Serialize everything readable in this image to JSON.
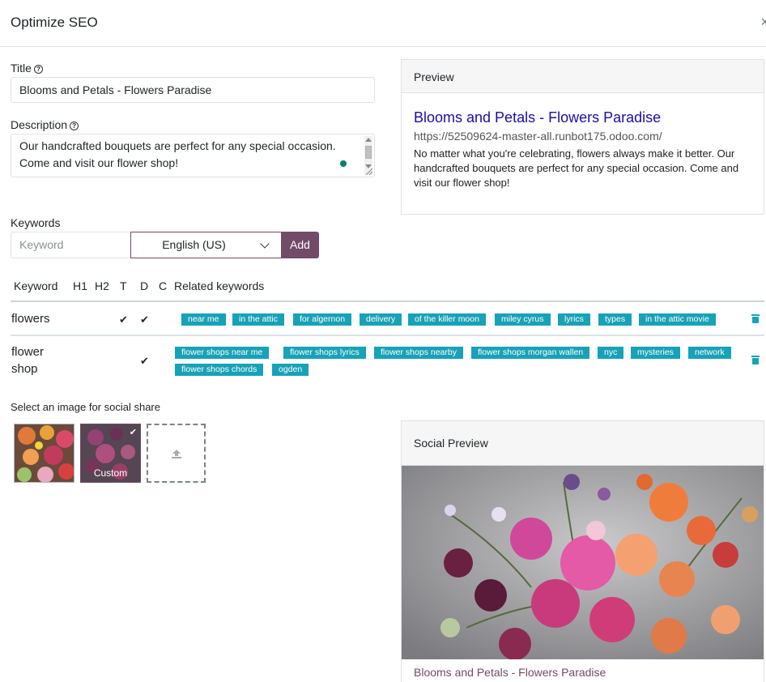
{
  "dialog": {
    "title": "Optimize SEO",
    "close_glyph": "×"
  },
  "form": {
    "title_label": "Title",
    "title_value": "Blooms and Petals - Flowers Paradise",
    "description_label": "Description",
    "description_value": "Our handcrafted bouquets are perfect for any special occasion. Come and visit our flower shop!",
    "keywords_label": "Keywords",
    "keyword_placeholder": "Keyword",
    "language": "English (US)",
    "add_label": "Add"
  },
  "table": {
    "headers": [
      "Keyword",
      "H1",
      "H2",
      "T",
      "D",
      "C",
      "Related keywords"
    ],
    "rows": [
      {
        "keyword": "flowers",
        "t": "✔",
        "d": "✔",
        "related": [
          "near me",
          "in the attic",
          "for algernon",
          "delivery",
          "of the killer moon",
          "miley cyrus",
          "lyrics",
          "types",
          "in the attic movie"
        ]
      },
      {
        "keyword_line1": "flower",
        "keyword_line2": "shop",
        "d": "✔",
        "related": [
          "flower shops near me",
          "flower shops lyrics",
          "flower shops nearby",
          "flower shops morgan wallen",
          "nyc",
          "mysteries",
          "network",
          "flower shops chords",
          "ogden"
        ]
      }
    ]
  },
  "social": {
    "select_label": "Select an image for social share",
    "custom_label": "Custom",
    "check_glyph": "✔"
  },
  "preview": {
    "header": "Preview",
    "title": "Blooms and Petals - Flowers Paradise",
    "url": "https://52509624-master-all.runbot175.odoo.com/",
    "description": "No matter what you're celebrating, flowers always make it better. Our handcrafted bouquets are perfect for any special occasion. Come and visit our flower shop!"
  },
  "social_preview": {
    "header": "Social Preview",
    "title": "Blooms and Petals - Flowers Paradise"
  },
  "colors": {
    "accent": "#714b67",
    "tag": "#17a2b8",
    "link": "#1a0dab"
  }
}
